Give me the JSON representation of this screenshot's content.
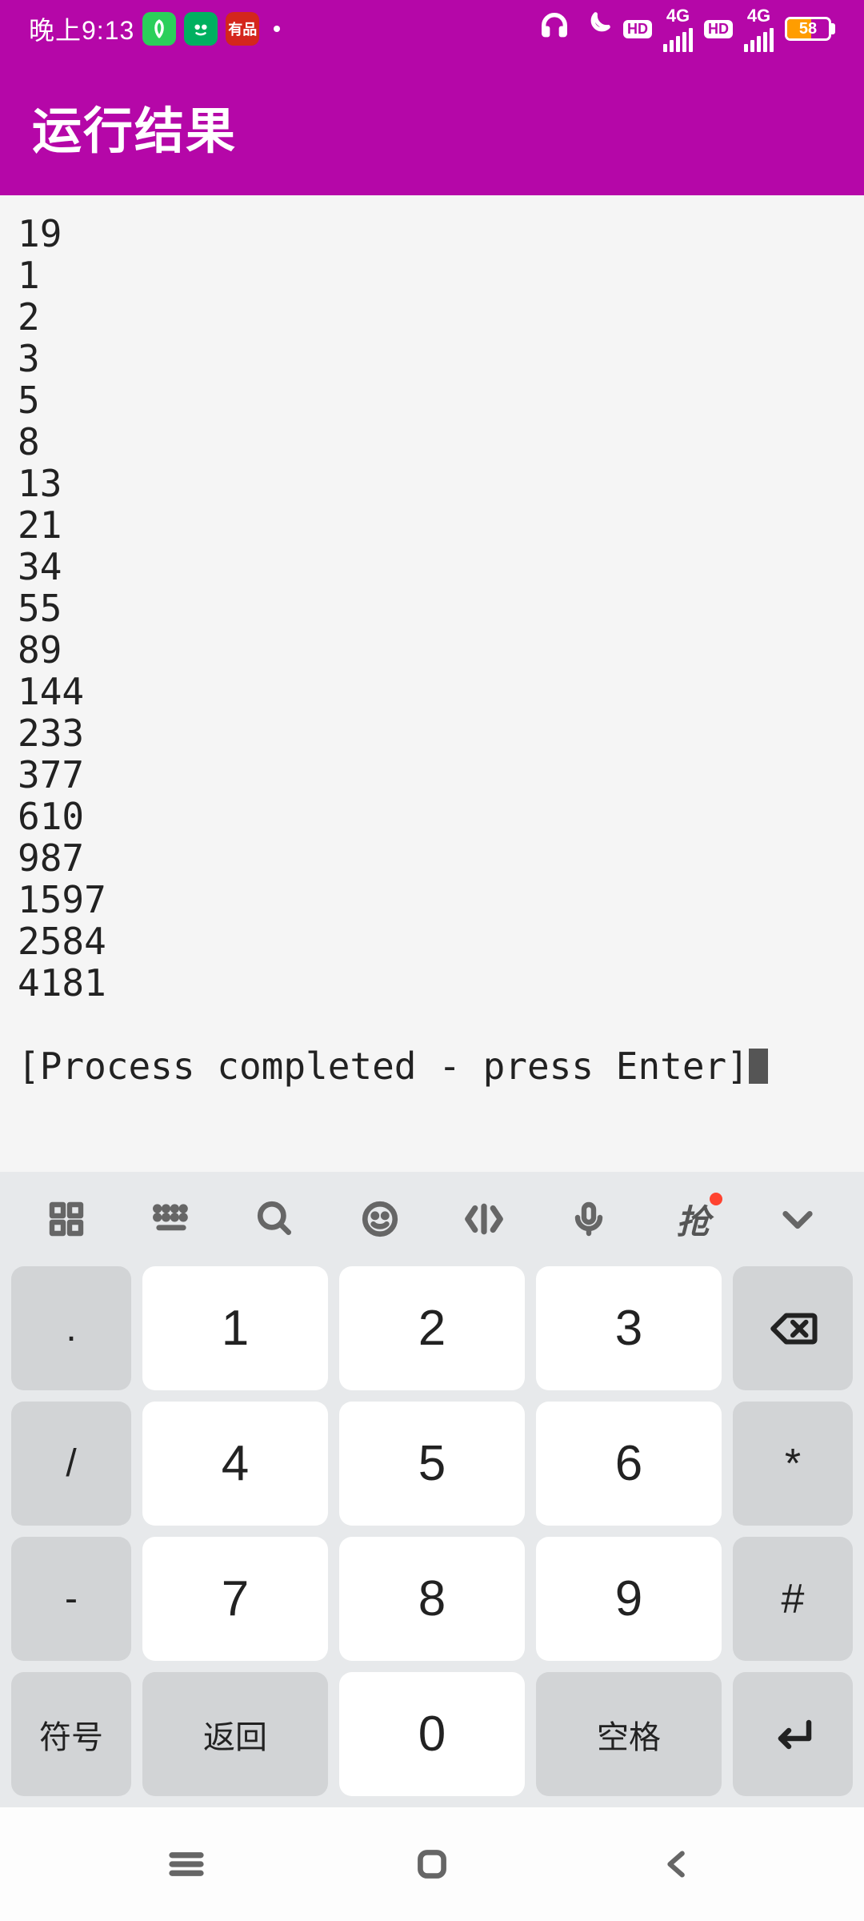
{
  "status_bar": {
    "time": "晚上9:13",
    "battery_pct": "58",
    "network_label": "4G",
    "hd_label": "HD"
  },
  "header": {
    "title": "运行结果"
  },
  "terminal": {
    "lines": [
      "19",
      "1",
      "2",
      "3",
      "5",
      "8",
      "13",
      "21",
      "34",
      "55",
      "89",
      "144",
      "233",
      "377",
      "610",
      "987",
      "1597",
      "2584",
      "4181"
    ],
    "footer": "[Process completed - press Enter]"
  },
  "keyboard": {
    "toolbar": {
      "grab_label": "抢"
    },
    "side_left": [
      ".",
      "/",
      "+",
      "-"
    ],
    "numbers": [
      [
        "1",
        "2",
        "3"
      ],
      [
        "4",
        "5",
        "6"
      ],
      [
        "7",
        "8",
        "9"
      ]
    ],
    "side_right": {
      "backspace": "⌫",
      "star": "*",
      "hash": "#"
    },
    "bottom": {
      "symbols": "符号",
      "back": "返回",
      "zero": "0",
      "space": "空格",
      "enter": "↵"
    }
  }
}
